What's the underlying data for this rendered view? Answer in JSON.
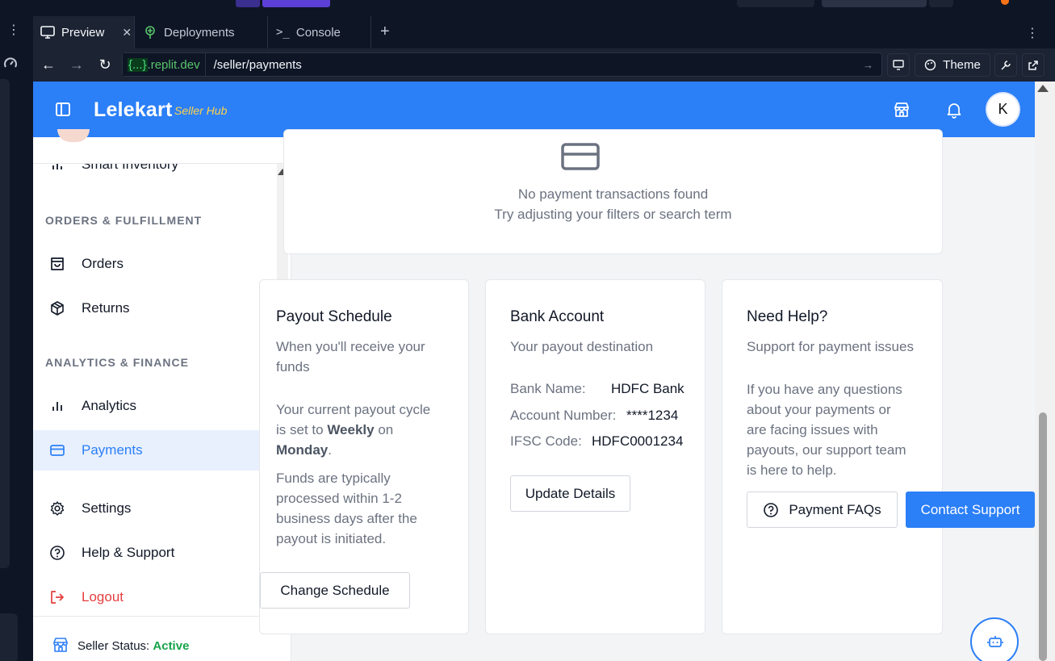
{
  "ide": {
    "tabs": [
      {
        "label": "Preview",
        "icon": "monitor-icon",
        "closable": true,
        "active": true
      },
      {
        "label": "Deployments",
        "icon": "deployments-icon",
        "active": false
      },
      {
        "label": "Console",
        "icon": "terminal-icon",
        "active": false
      }
    ],
    "url": {
      "host_badge": "{...}",
      "host": ".replit.dev",
      "path": "/seller/payments"
    },
    "theme_label": "Theme"
  },
  "app": {
    "brand": "Lelekart",
    "brand_sub": "Seller Hub",
    "avatar_initial": "K",
    "colors": {
      "primary": "#2b7ff7",
      "accent": "#fcd34d",
      "active_status": "#16a34a",
      "danger": "#e53e3e"
    }
  },
  "sidebar": {
    "items": [
      {
        "label": "Smart Inventory",
        "icon": "bar-chart-icon"
      },
      {
        "label": "Orders",
        "icon": "shopping-bag-icon"
      },
      {
        "label": "Returns",
        "icon": "package-icon"
      },
      {
        "label": "Analytics",
        "icon": "bar-chart-icon"
      },
      {
        "label": "Payments",
        "icon": "credit-card-icon",
        "active": true
      },
      {
        "label": "Settings",
        "icon": "gear-icon"
      },
      {
        "label": "Help & Support",
        "icon": "help-circle-icon"
      },
      {
        "label": "Logout",
        "icon": "logout-icon"
      }
    ],
    "sections": [
      "ORDERS & FULFILLMENT",
      "ANALYTICS & FINANCE"
    ],
    "footer": {
      "label": "Seller Status:",
      "status": "Active"
    }
  },
  "transactions": {
    "empty_title": "No payment transactions found",
    "empty_hint": "Try adjusting your filters or search term"
  },
  "payout": {
    "title": "Payout Schedule",
    "subtitle_line1": "When you'll receive your",
    "subtitle_line2": "funds",
    "cycle_prefix": "Your current payout cycle",
    "cycle_mid": "is set to ",
    "cycle_value": "Weekly",
    "cycle_on": " on",
    "cycle_day": "Monday",
    "cycle_end": ".",
    "note_lines": [
      "Funds are typically",
      "processed within 1-2",
      "business days after the",
      "payout is initiated."
    ],
    "button": "Change Schedule"
  },
  "bank": {
    "title": "Bank Account",
    "subtitle": "Your payout destination",
    "rows": [
      {
        "label": "Bank Name:",
        "value": "HDFC Bank"
      },
      {
        "label": "Account Number:",
        "value": "****1234"
      },
      {
        "label": "IFSC Code:",
        "value": "HDFC0001234"
      }
    ],
    "button": "Update Details"
  },
  "help": {
    "title": "Need Help?",
    "subtitle": "Support for payment issues",
    "body_lines": [
      "If you have any questions",
      "about your payments or",
      "are facing issues with",
      "payouts, our support team",
      "is here to help."
    ],
    "faq_button": "Payment FAQs",
    "contact_button": "Contact Support"
  }
}
